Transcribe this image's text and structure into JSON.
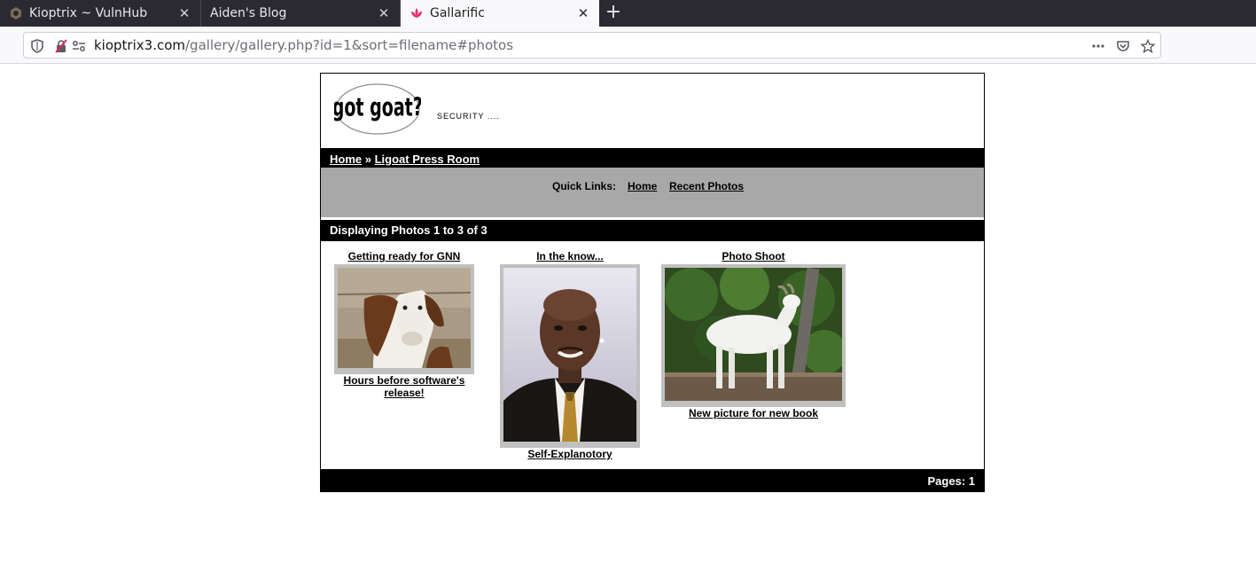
{
  "browser": {
    "tabs": [
      {
        "title": "Kioptrix ~ VulnHub",
        "icon": "vulnhub-icon",
        "active": false
      },
      {
        "title": "Aiden's Blog",
        "icon": "blank-page-icon",
        "active": false
      },
      {
        "title": "Gallarific",
        "icon": "lotus-icon",
        "active": true
      }
    ],
    "new_tab_label": "+",
    "close_label": "✕",
    "url_host": "kioptrix3.com",
    "url_path": "/gallery/gallery.php?id=1&sort=filename#photos"
  },
  "site": {
    "logo_text": "got goat?",
    "tagline": "SECURITY ....",
    "breadcrumb": {
      "home": "Home",
      "separator": "»",
      "current": "Ligoat Press Room"
    },
    "quick_links": {
      "label": "Quick Links:",
      "home": "Home",
      "recent": "Recent Photos"
    },
    "displaying": "Displaying Photos 1 to 3 of 3",
    "photos": [
      {
        "title": "Getting ready for GNN",
        "caption": "Hours before software's release!"
      },
      {
        "title": "In the know...",
        "caption": "Self-Explanotory"
      },
      {
        "title": "Photo Shoot",
        "caption": "New picture for new book"
      }
    ],
    "pages": "Pages: 1"
  }
}
